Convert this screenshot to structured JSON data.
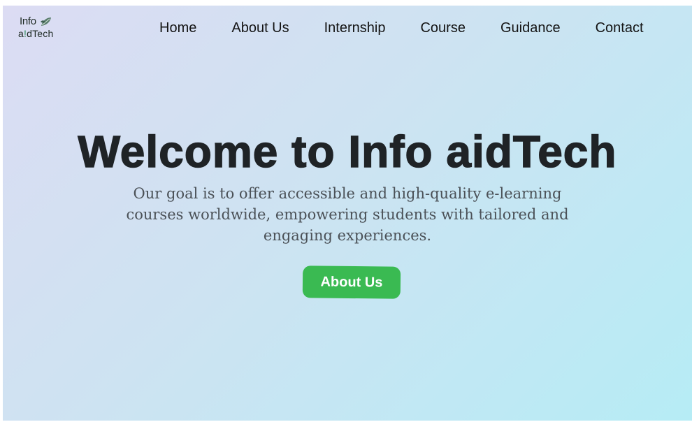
{
  "logo": {
    "line1": "Info",
    "line2_a": "a",
    "line2_accent": "!",
    "line2_rest": "dTech",
    "icon": "leaf-icon"
  },
  "nav": {
    "items": [
      {
        "label": "Home"
      },
      {
        "label": "About Us"
      },
      {
        "label": "Internship"
      },
      {
        "label": "Course"
      },
      {
        "label": "Guidance"
      },
      {
        "label": "Contact"
      }
    ]
  },
  "hero": {
    "title": "Welcome to Info aidTech",
    "subtitle": "Our goal is to offer accessible and high-quality e-learning courses worldwide, empowering students with tailored and engaging experiences.",
    "cta_label": "About Us"
  },
  "colors": {
    "background_start": "#dcdcf3",
    "background_end": "#b6ecf5",
    "title": "#1f2326",
    "subtitle": "#4b5157",
    "cta_background": "#3aba52",
    "cta_text": "#ffffff"
  }
}
